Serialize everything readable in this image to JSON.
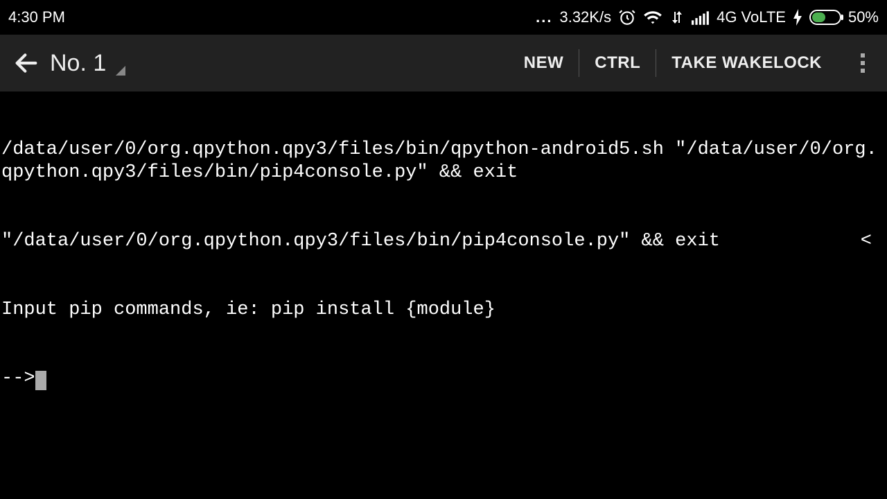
{
  "status": {
    "time": "4:30 PM",
    "net_speed": "3.32K/s",
    "net_label": "4G VoLTE",
    "battery_pct": "50%"
  },
  "appbar": {
    "session_title": "No. 1",
    "new_label": "NEW",
    "ctrl_label": "CTRL",
    "wakelock_label": "TAKE WAKELOCK"
  },
  "terminal": {
    "line1": "/data/user/0/org.qpython.qpy3/files/bin/qpython-android5.sh \"/data/user/0/org.qpython.qpy3/files/bin/pip4console.py\" && exit",
    "line2_left": "\"/data/user/0/org.qpython.qpy3/files/bin/pip4console.py\" && exit",
    "line2_right": "<",
    "line3": "Input pip commands, ie: pip install {module}",
    "prompt": "-->"
  }
}
